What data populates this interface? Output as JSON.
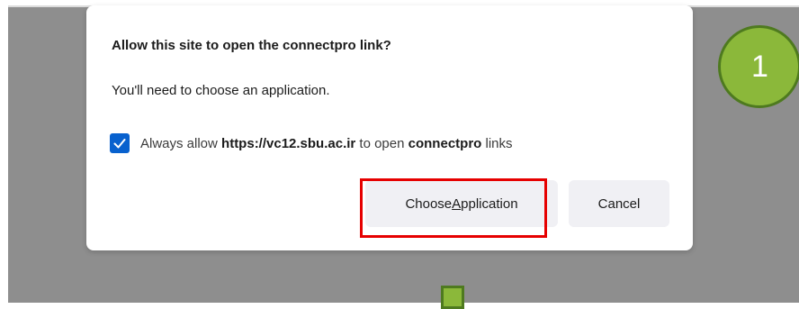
{
  "dialog": {
    "title": "Allow this site to open the connectpro link?",
    "message": "You'll need to choose an application.",
    "checkbox": {
      "checked": true,
      "prefix": "Always allow ",
      "site": "https://vc12.sbu.ac.ir",
      "middle": " to open ",
      "protocol": "connectpro",
      "suffix": " links"
    },
    "buttons": {
      "choose_prefix": "Choose ",
      "choose_access_letter": "A",
      "choose_rest": "pplication",
      "cancel": "Cancel"
    }
  },
  "annotation": {
    "step_number": "1",
    "highlight_color": "#e60000",
    "badge_color": "#8bb83a"
  },
  "colors": {
    "backdrop": "#8e8e8e",
    "checkbox_accent": "#0861ce",
    "button_bg": "#f0f0f4"
  }
}
